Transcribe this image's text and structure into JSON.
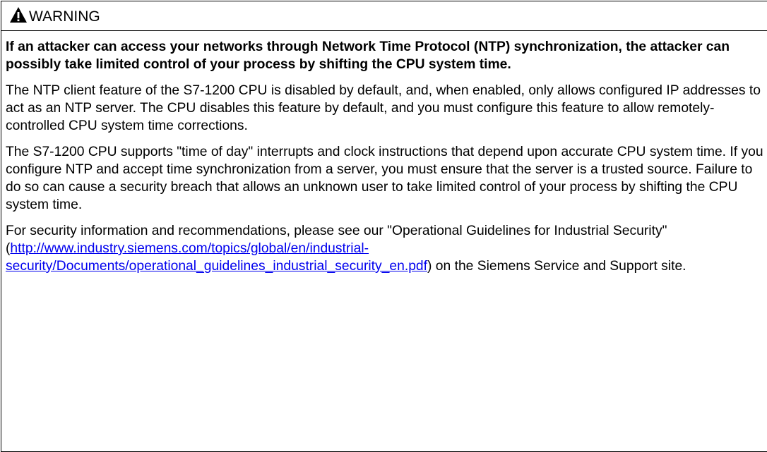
{
  "header": {
    "title": "WARNING",
    "icon": "warning-triangle-icon"
  },
  "paragraphs": {
    "p1": "If an attacker can access your networks through Network Time Protocol (NTP) synchronization, the attacker can possibly take limited control of your process by shifting the CPU system time.",
    "p2": "The NTP client feature of the S7-1200 CPU is disabled by default, and, when enabled, only allows configured IP addresses to act as an NTP server. The CPU disables this feature by default, and you must configure this feature to allow remotely-controlled CPU system time corrections.",
    "p3": "The S7-1200 CPU supports \"time of day\" interrupts and clock instructions that depend upon accurate CPU system time. If you configure NTP and accept time synchronization from a server, you must ensure that the server is a trusted source. Failure to do so can cause a security breach that allows an unknown user to take limited control of your process by shifting the CPU system time.",
    "p4_before": "For security information and recommendations, please see our \"Operational Guidelines for Industrial Security\" (",
    "p4_link": "http://www.industry.siemens.com/topics/global/en/industrial-security/Documents/operational_guidelines_industrial_security_en.pdf",
    "p4_after": ") on the Siemens Service and Support site."
  }
}
